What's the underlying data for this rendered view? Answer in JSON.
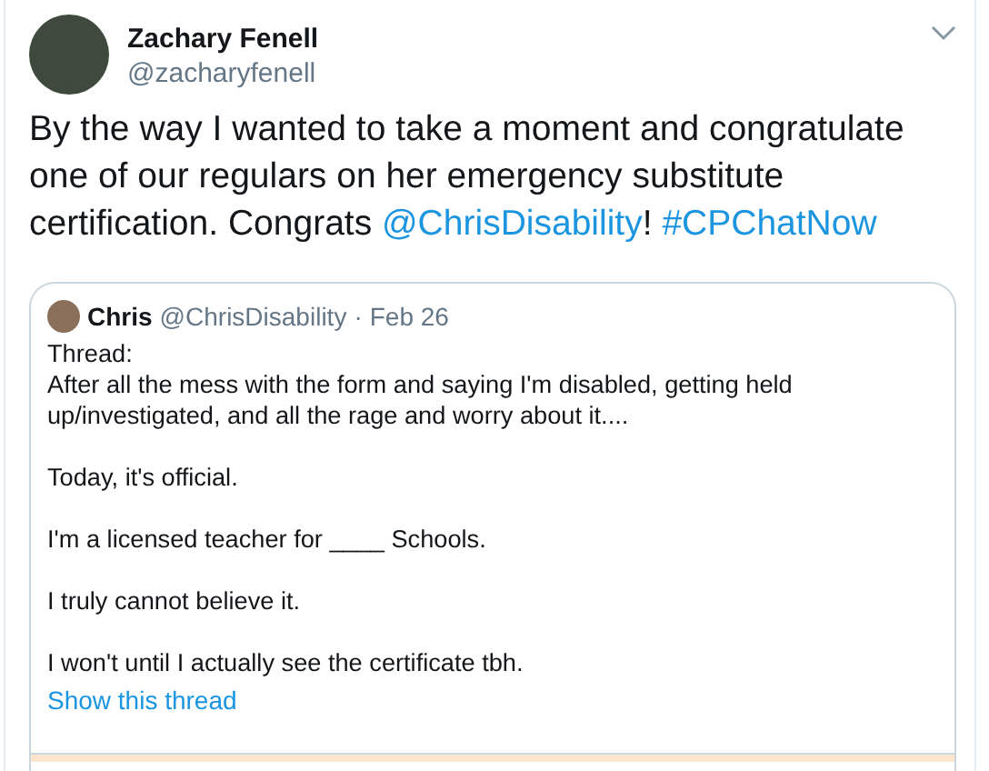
{
  "author": {
    "name": "Zachary Fenell",
    "handle": "@zacharyfenell"
  },
  "body": [
    {
      "kind": "text",
      "text": "By the way I wanted to take a moment and congratulate one of our regulars on her emergency substitute certification. Congrats "
    },
    {
      "kind": "mention",
      "text": "@ChrisDisability"
    },
    {
      "kind": "text",
      "text": "! "
    },
    {
      "kind": "hashtag",
      "text": "#CPChatNow"
    }
  ],
  "quoted": {
    "name": "Chris",
    "handle": "@ChrisDisability",
    "separator": "·",
    "date": "Feb 26",
    "paragraphs": [
      [
        "Thread:",
        "After all the mess with the form and saying I'm disabled, getting held up/investigated, and all the rage and worry about it...."
      ],
      [
        "Today, it's official."
      ],
      [
        "I'm a licensed teacher for ____ Schools."
      ],
      [
        "I truly cannot believe it."
      ],
      [
        "I won't until I actually see the certificate tbh."
      ]
    ],
    "link": "Show this thread"
  }
}
